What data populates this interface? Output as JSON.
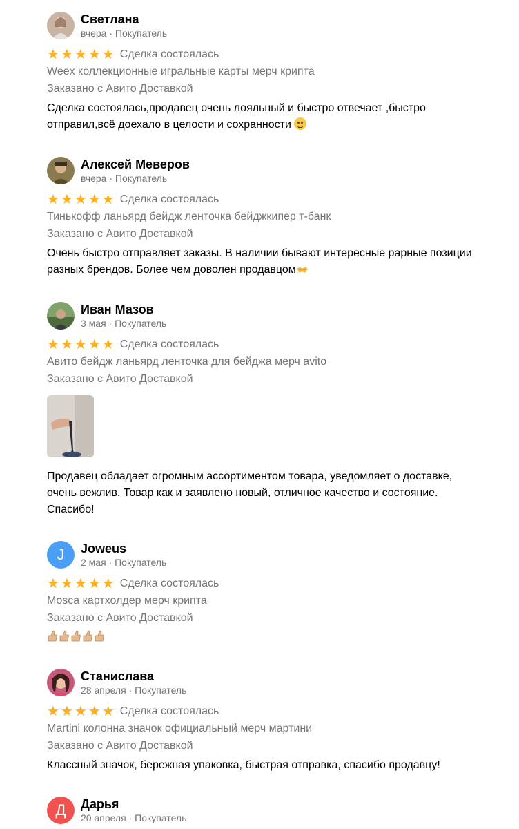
{
  "reviews": [
    {
      "name": "Светлана",
      "meta": "вчера · Покупатель",
      "status": "Сделка состоялась",
      "item": "Weex коллекционные игральные карты мерч крипта",
      "delivery": "Заказано с Авито Доставкой",
      "text_line1": "Сделка состоялась,продавец очень лояльный и быстро отвечает ,быстро",
      "text_line2": "отправил,всё доехало в целости и сохранности",
      "rating": 5
    },
    {
      "name": "Алексей Меверов",
      "meta": "вчера · Покупатель",
      "status": "Сделка состоялась",
      "item": "Тинькофф ланьярд бейдж ленточка бейджкипер т-банк",
      "delivery": "Заказано с Авито Доставкой",
      "text_line1": "Очень быстро отправляет заказы. В наличии бывают интересные рарные позиции",
      "text_line2": "разных брендов. Более чем доволен продавцом",
      "rating": 5
    },
    {
      "name": "Иван Мазов",
      "meta": "3 мая · Покупатель",
      "status": "Сделка состоялась",
      "item": "Авито бейдж ланьярд ленточка для бейджа мерч avito",
      "delivery": "Заказано с Авито Доставкой",
      "text_line1": "Продавец обладает огромным ассортиментом товара, уведомляет о доставке,",
      "text_line2": "очень вежлив. Товар как и заявлено новый, отличное качество и состояние.",
      "text_line3": "Спасибо!",
      "rating": 5
    },
    {
      "name": "Joweus",
      "meta": "2 мая · Покупатель",
      "avatar_letter": "J",
      "avatar_color": "#4a9ff5",
      "status": "Сделка состоялась",
      "item": "Mosca картхолдер мерч крипта",
      "delivery": "Заказано с Авито Доставкой",
      "rating": 5
    },
    {
      "name": "Станислава",
      "meta": "28 апреля · Покупатель",
      "status": "Сделка состоялась",
      "item": "Martini колонна значок официальный мерч мартини",
      "delivery": "Заказано с Авито Доставкой",
      "text_line1": "Классный значок, бережная упаковка, быстрая отправка, спасибо продавцу!",
      "rating": 5
    },
    {
      "name": "Дарья",
      "meta": "20 апреля · Покупатель",
      "avatar_letter": "Д",
      "avatar_color": "#f0524f"
    }
  ],
  "star_glyph": "★",
  "star_color": "#ffb021"
}
